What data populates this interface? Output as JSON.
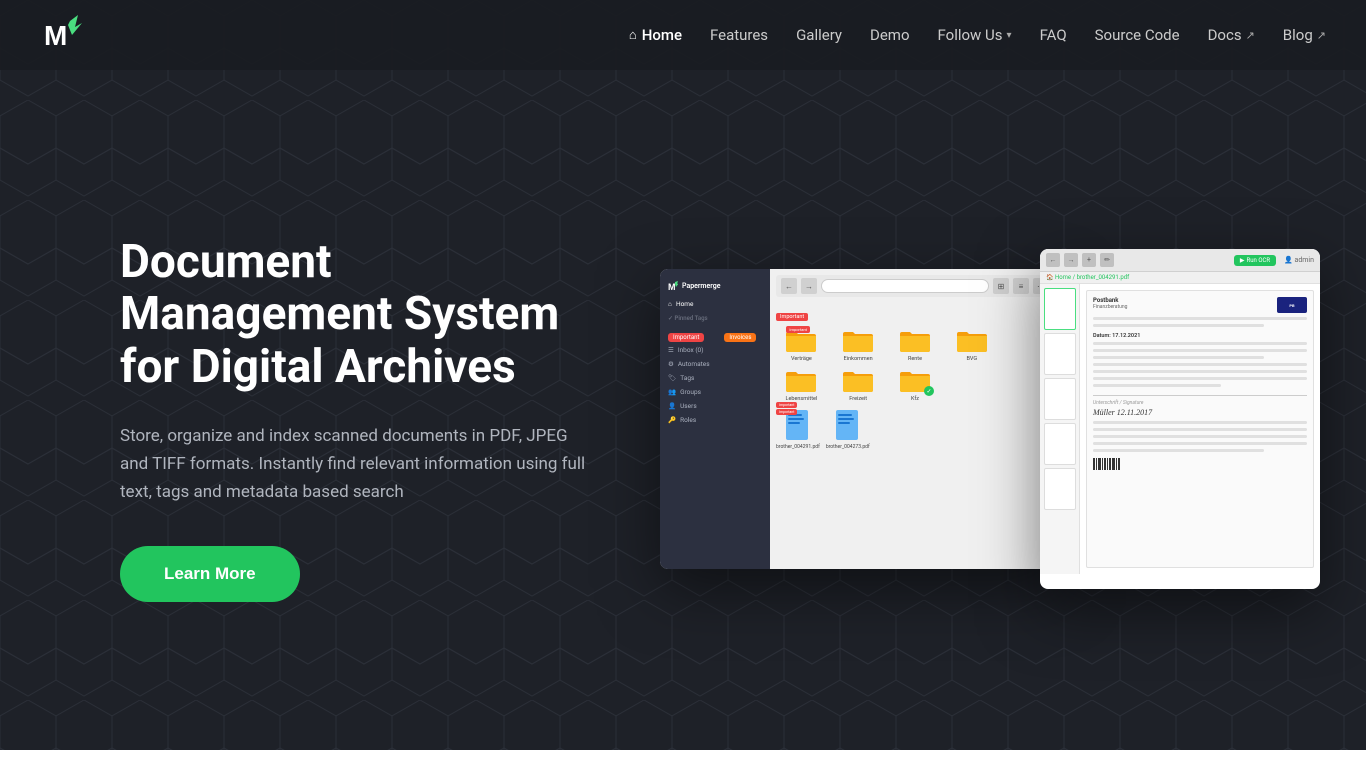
{
  "brand": {
    "name": "Papermerge",
    "logo_text": "M"
  },
  "nav": {
    "links": [
      {
        "id": "home",
        "label": "Home",
        "active": true,
        "icon": "🏠",
        "external": false,
        "dropdown": false
      },
      {
        "id": "features",
        "label": "Features",
        "active": false,
        "external": false,
        "dropdown": false
      },
      {
        "id": "gallery",
        "label": "Gallery",
        "active": false,
        "external": false,
        "dropdown": false
      },
      {
        "id": "demo",
        "label": "Demo",
        "active": false,
        "external": false,
        "dropdown": false
      },
      {
        "id": "follow-us",
        "label": "Follow Us",
        "active": false,
        "external": false,
        "dropdown": true
      },
      {
        "id": "faq",
        "label": "FAQ",
        "active": false,
        "external": false,
        "dropdown": false
      },
      {
        "id": "source-code",
        "label": "Source Code",
        "active": false,
        "external": false,
        "dropdown": false
      },
      {
        "id": "docs",
        "label": "Docs",
        "active": false,
        "external": true,
        "dropdown": false
      },
      {
        "id": "blog",
        "label": "Blog",
        "active": false,
        "external": true,
        "dropdown": false
      }
    ]
  },
  "hero": {
    "title": "Document Management System for Digital Archives",
    "subtitle": "Store, organize and index scanned documents in PDF, JPEG and TIFF formats. Instantly find relevant information using full text, tags and metadata based search",
    "cta_label": "Learn More"
  },
  "sidebar": {
    "app_name": "Papermerge",
    "items": [
      {
        "label": "Home"
      },
      {
        "section": "Pinned Tags"
      },
      {
        "label": "Important",
        "tag": "red"
      },
      {
        "label": "Invoices",
        "tag": "orange"
      },
      {
        "label": "Inbox (0)"
      },
      {
        "label": "Automates"
      },
      {
        "label": "Tags"
      },
      {
        "label": "Groups"
      },
      {
        "label": "Users"
      },
      {
        "label": "Roles"
      }
    ]
  },
  "folders": [
    {
      "label": "Verträge",
      "tag": "important"
    },
    {
      "label": "Einkommen"
    },
    {
      "label": "Rente"
    },
    {
      "label": "BVG"
    },
    {
      "label": "Lebensmittel",
      "tag": ""
    },
    {
      "label": "Freizeit"
    },
    {
      "label": "Kfz"
    }
  ],
  "files": [
    {
      "label": "brother_004291.pdf",
      "tag": "important"
    },
    {
      "label": "brother_004273.pdf"
    }
  ],
  "doc_viewer": {
    "breadcrumb": "Home / brother_004291.pdf",
    "run_ocr": "Run OCR"
  },
  "colors": {
    "accent_green": "#22c55e",
    "background": "#1e2128",
    "nav_bg": "#191c22",
    "text_muted": "#b0b5be"
  }
}
